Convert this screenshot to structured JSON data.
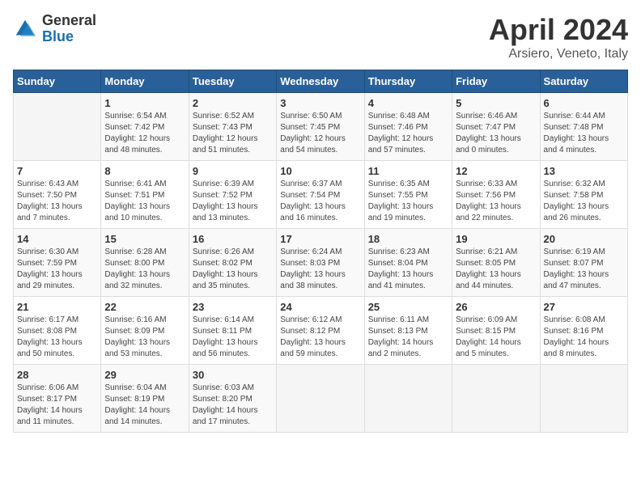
{
  "header": {
    "logo_general": "General",
    "logo_blue": "Blue",
    "title": "April 2024",
    "location": "Arsiero, Veneto, Italy"
  },
  "calendar": {
    "days_of_week": [
      "Sunday",
      "Monday",
      "Tuesday",
      "Wednesday",
      "Thursday",
      "Friday",
      "Saturday"
    ],
    "weeks": [
      [
        {
          "day": "",
          "info": ""
        },
        {
          "day": "1",
          "info": "Sunrise: 6:54 AM\nSunset: 7:42 PM\nDaylight: 12 hours\nand 48 minutes."
        },
        {
          "day": "2",
          "info": "Sunrise: 6:52 AM\nSunset: 7:43 PM\nDaylight: 12 hours\nand 51 minutes."
        },
        {
          "day": "3",
          "info": "Sunrise: 6:50 AM\nSunset: 7:45 PM\nDaylight: 12 hours\nand 54 minutes."
        },
        {
          "day": "4",
          "info": "Sunrise: 6:48 AM\nSunset: 7:46 PM\nDaylight: 12 hours\nand 57 minutes."
        },
        {
          "day": "5",
          "info": "Sunrise: 6:46 AM\nSunset: 7:47 PM\nDaylight: 13 hours\nand 0 minutes."
        },
        {
          "day": "6",
          "info": "Sunrise: 6:44 AM\nSunset: 7:48 PM\nDaylight: 13 hours\nand 4 minutes."
        }
      ],
      [
        {
          "day": "7",
          "info": "Sunrise: 6:43 AM\nSunset: 7:50 PM\nDaylight: 13 hours\nand 7 minutes."
        },
        {
          "day": "8",
          "info": "Sunrise: 6:41 AM\nSunset: 7:51 PM\nDaylight: 13 hours\nand 10 minutes."
        },
        {
          "day": "9",
          "info": "Sunrise: 6:39 AM\nSunset: 7:52 PM\nDaylight: 13 hours\nand 13 minutes."
        },
        {
          "day": "10",
          "info": "Sunrise: 6:37 AM\nSunset: 7:54 PM\nDaylight: 13 hours\nand 16 minutes."
        },
        {
          "day": "11",
          "info": "Sunrise: 6:35 AM\nSunset: 7:55 PM\nDaylight: 13 hours\nand 19 minutes."
        },
        {
          "day": "12",
          "info": "Sunrise: 6:33 AM\nSunset: 7:56 PM\nDaylight: 13 hours\nand 22 minutes."
        },
        {
          "day": "13",
          "info": "Sunrise: 6:32 AM\nSunset: 7:58 PM\nDaylight: 13 hours\nand 26 minutes."
        }
      ],
      [
        {
          "day": "14",
          "info": "Sunrise: 6:30 AM\nSunset: 7:59 PM\nDaylight: 13 hours\nand 29 minutes."
        },
        {
          "day": "15",
          "info": "Sunrise: 6:28 AM\nSunset: 8:00 PM\nDaylight: 13 hours\nand 32 minutes."
        },
        {
          "day": "16",
          "info": "Sunrise: 6:26 AM\nSunset: 8:02 PM\nDaylight: 13 hours\nand 35 minutes."
        },
        {
          "day": "17",
          "info": "Sunrise: 6:24 AM\nSunset: 8:03 PM\nDaylight: 13 hours\nand 38 minutes."
        },
        {
          "day": "18",
          "info": "Sunrise: 6:23 AM\nSunset: 8:04 PM\nDaylight: 13 hours\nand 41 minutes."
        },
        {
          "day": "19",
          "info": "Sunrise: 6:21 AM\nSunset: 8:05 PM\nDaylight: 13 hours\nand 44 minutes."
        },
        {
          "day": "20",
          "info": "Sunrise: 6:19 AM\nSunset: 8:07 PM\nDaylight: 13 hours\nand 47 minutes."
        }
      ],
      [
        {
          "day": "21",
          "info": "Sunrise: 6:17 AM\nSunset: 8:08 PM\nDaylight: 13 hours\nand 50 minutes."
        },
        {
          "day": "22",
          "info": "Sunrise: 6:16 AM\nSunset: 8:09 PM\nDaylight: 13 hours\nand 53 minutes."
        },
        {
          "day": "23",
          "info": "Sunrise: 6:14 AM\nSunset: 8:11 PM\nDaylight: 13 hours\nand 56 minutes."
        },
        {
          "day": "24",
          "info": "Sunrise: 6:12 AM\nSunset: 8:12 PM\nDaylight: 13 hours\nand 59 minutes."
        },
        {
          "day": "25",
          "info": "Sunrise: 6:11 AM\nSunset: 8:13 PM\nDaylight: 14 hours\nand 2 minutes."
        },
        {
          "day": "26",
          "info": "Sunrise: 6:09 AM\nSunset: 8:15 PM\nDaylight: 14 hours\nand 5 minutes."
        },
        {
          "day": "27",
          "info": "Sunrise: 6:08 AM\nSunset: 8:16 PM\nDaylight: 14 hours\nand 8 minutes."
        }
      ],
      [
        {
          "day": "28",
          "info": "Sunrise: 6:06 AM\nSunset: 8:17 PM\nDaylight: 14 hours\nand 11 minutes."
        },
        {
          "day": "29",
          "info": "Sunrise: 6:04 AM\nSunset: 8:19 PM\nDaylight: 14 hours\nand 14 minutes."
        },
        {
          "day": "30",
          "info": "Sunrise: 6:03 AM\nSunset: 8:20 PM\nDaylight: 14 hours\nand 17 minutes."
        },
        {
          "day": "",
          "info": ""
        },
        {
          "day": "",
          "info": ""
        },
        {
          "day": "",
          "info": ""
        },
        {
          "day": "",
          "info": ""
        }
      ]
    ]
  }
}
